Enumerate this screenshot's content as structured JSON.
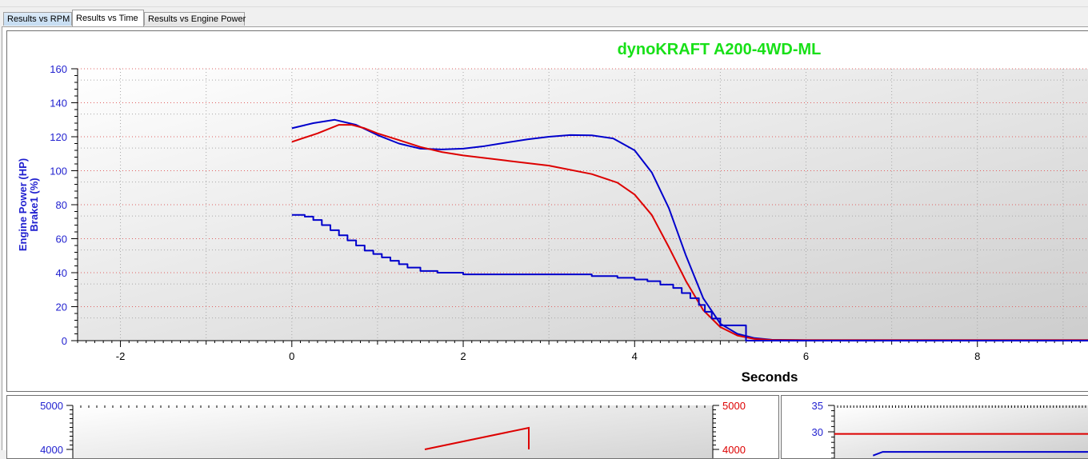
{
  "tabs": [
    {
      "label": "Results vs RPM",
      "active": false
    },
    {
      "label": "Results vs Time",
      "active": true
    },
    {
      "label": "Results vs Engine Power",
      "active": false
    }
  ],
  "colors": {
    "title": "#18e018",
    "axis_blue": "#1f1fcf",
    "series_blue": "#0000cc",
    "series_red": "#dd0000",
    "grid_red": "#e06060",
    "grid_gray": "#a8a8a8"
  },
  "chart_data": [
    {
      "type": "line",
      "title": "dynoKRAFT A200-4WD-ML",
      "xlabel": "Seconds",
      "ylabel_lines": [
        "Engine Power (HP)",
        "Brake1 (%)"
      ],
      "xlim": [
        -2.5,
        9.3
      ],
      "ylim": [
        0,
        160
      ],
      "xticks": [
        -2,
        0,
        2,
        4,
        6,
        8
      ],
      "yticks": [
        0,
        20,
        40,
        60,
        80,
        100,
        120,
        140,
        160
      ],
      "grid": true,
      "series": [
        {
          "color": "#0000cc",
          "x": [
            0,
            0.25,
            0.5,
            0.75,
            1.0,
            1.25,
            1.5,
            1.75,
            2.0,
            2.25,
            2.5,
            2.75,
            3.0,
            3.25,
            3.5,
            3.75,
            4.0,
            4.2,
            4.4,
            4.6,
            4.8,
            5.0,
            5.2,
            5.4,
            5.6,
            6.0,
            7.0,
            8.0,
            9.3
          ],
          "y": [
            125,
            128,
            130,
            127,
            121,
            116,
            113,
            112.5,
            113,
            114.5,
            116.5,
            118.5,
            120,
            121,
            120.8,
            119,
            112,
            99,
            78,
            50,
            25,
            10,
            4,
            1.5,
            0.5,
            0.3,
            0.3,
            0.3,
            0.3
          ]
        },
        {
          "color": "#dd0000",
          "x": [
            0,
            0.3,
            0.55,
            0.7,
            0.85,
            1.0,
            1.25,
            1.5,
            1.75,
            2.0,
            2.5,
            3.0,
            3.5,
            3.8,
            4.0,
            4.2,
            4.4,
            4.6,
            4.8,
            5.0,
            5.2,
            5.4,
            5.6,
            6.0,
            7.0,
            8.0,
            9.3
          ],
          "y": [
            117,
            122,
            127,
            127,
            125,
            122,
            118,
            114,
            111,
            109,
            106,
            103,
            98,
            93,
            86,
            74,
            55,
            35,
            18,
            8,
            3,
            1,
            0.4,
            0.3,
            0.3,
            0.3,
            0.3
          ]
        },
        {
          "color": "#0000cc",
          "step": true,
          "x": [
            0,
            0.15,
            0.25,
            0.35,
            0.45,
            0.55,
            0.65,
            0.75,
            0.85,
            0.95,
            1.05,
            1.15,
            1.25,
            1.35,
            1.5,
            1.7,
            2.0,
            3.0,
            3.5,
            3.8,
            4.0,
            4.15,
            4.3,
            4.45,
            4.55,
            4.65,
            4.75,
            4.82,
            4.9,
            5.0,
            5.3,
            6.0,
            9.3
          ],
          "y": [
            74,
            73,
            71,
            68,
            65,
            62,
            59,
            56,
            53,
            51,
            49,
            47,
            45,
            43,
            41,
            40,
            39,
            39,
            38,
            37,
            36,
            35,
            33,
            31,
            28,
            25,
            21,
            17,
            13,
            9,
            0,
            0,
            0
          ]
        }
      ]
    },
    {
      "type": "line",
      "ylim": [
        4000,
        5000
      ],
      "yticks": [
        4000,
        5000
      ],
      "y2lim": [
        4000,
        5000
      ],
      "y2ticks": [
        4000,
        5000
      ],
      "xlim": [
        0,
        8
      ],
      "series": [
        {
          "color": "#dd0000",
          "x": [
            4.4,
            5.7,
            5.7
          ],
          "y": [
            4000,
            4490,
            4000
          ]
        }
      ]
    },
    {
      "type": "line",
      "ylim": [
        25,
        35
      ],
      "yticks": [
        30,
        35
      ],
      "xlim": [
        0,
        8
      ],
      "series": [
        {
          "color": "#dd0000",
          "x": [
            0,
            8
          ],
          "y": [
            29.6,
            29.6
          ]
        },
        {
          "color": "#0000cc",
          "x": [
            1.2,
            1.5,
            8
          ],
          "y": [
            25.5,
            26.2,
            26.2
          ]
        }
      ]
    }
  ]
}
